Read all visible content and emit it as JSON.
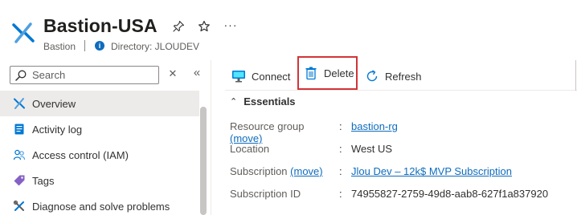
{
  "header": {
    "title": "Bastion-USA",
    "resource_type": "Bastion",
    "directory": "Directory: JLOUDEV",
    "pin_glyph": "📌",
    "star_glyph": "☆",
    "more_glyph": "···"
  },
  "sidebar": {
    "search_placeholder": "Search",
    "items": [
      {
        "label": "Overview",
        "icon": "bastion-icon",
        "active": true
      },
      {
        "label": "Activity log",
        "icon": "activity-log-icon"
      },
      {
        "label": "Access control (IAM)",
        "icon": "people-icon"
      },
      {
        "label": "Tags",
        "icon": "tag-icon"
      },
      {
        "label": "Diagnose and solve problems",
        "icon": "wrench-icon"
      }
    ]
  },
  "toolbar": {
    "connect_label": "Connect",
    "delete_label": "Delete",
    "refresh_label": "Refresh"
  },
  "essentials": {
    "title": "Essentials",
    "rows": [
      {
        "label": "Resource group",
        "move": "(move)",
        "value": "bastion-rg",
        "link": true
      },
      {
        "label": "Location",
        "value": "West US",
        "link": false
      },
      {
        "label": "Subscription",
        "move": "(move)",
        "value": "Jlou Dev – 12k$ MVP Subscription",
        "link": true
      },
      {
        "label": "Subscription ID",
        "value": "74955827-2759-49d8-aab8-627f1a837920",
        "link": false
      }
    ]
  },
  "colors": {
    "accent": "#0f6cbd",
    "highlight_border": "#d13438",
    "nav_active_bg": "#edebe9"
  }
}
